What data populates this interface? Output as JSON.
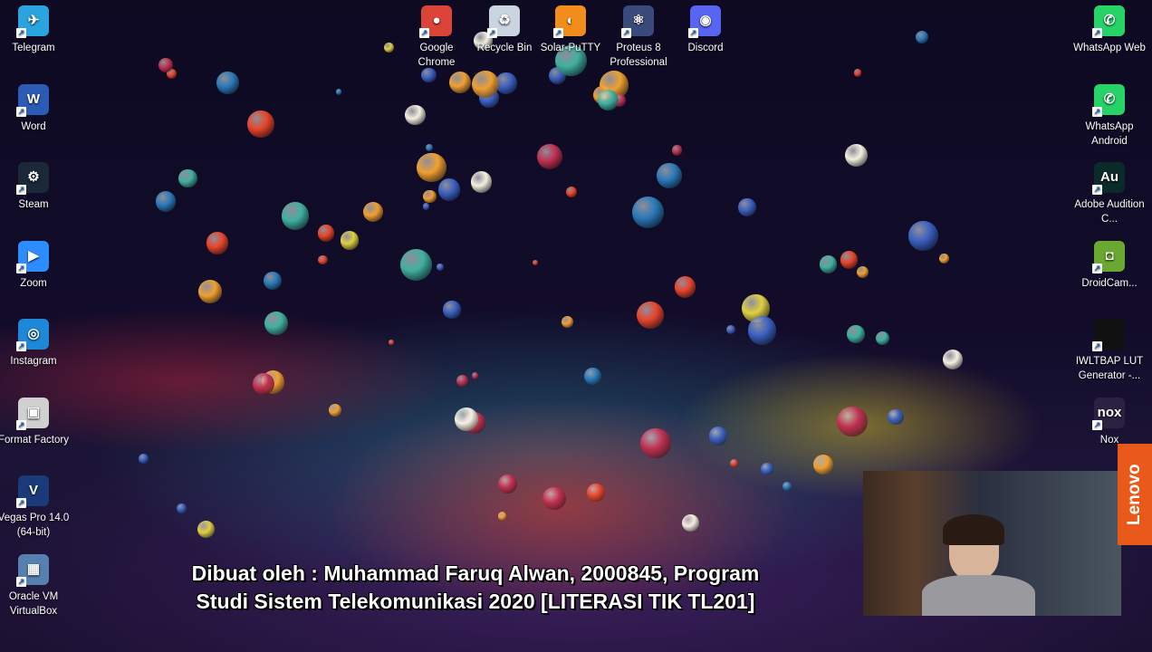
{
  "desktop_left": [
    {
      "label": "Telegram",
      "color": "#2aa3de",
      "sym": "✈"
    },
    {
      "label": "Word",
      "color": "#2b5bb5",
      "sym": "W"
    },
    {
      "label": "Steam",
      "color": "#1b2838",
      "sym": "⚙"
    },
    {
      "label": "Zoom",
      "color": "#2d8cff",
      "sym": "▶"
    },
    {
      "label": "Instagram",
      "color": "#1e88d8",
      "sym": "◎"
    },
    {
      "label": "Format Factory",
      "color": "#d0d0d0",
      "sym": "▣"
    },
    {
      "label": "Vegas Pro 14.0 (64-bit)",
      "color": "#1a3a7a",
      "sym": "V"
    },
    {
      "label": "Oracle VM VirtualBox",
      "color": "#5580b0",
      "sym": "▦"
    }
  ],
  "desktop_top": [
    {
      "label": "Google Chrome",
      "color": "#db4437",
      "sym": "●"
    },
    {
      "label": "Recycle Bin",
      "color": "#c9d4e0",
      "sym": "♻"
    },
    {
      "label": "Solar-PuTTY",
      "color": "#f28c1a",
      "sym": "◐"
    },
    {
      "label": "Proteus 8 Professional",
      "color": "#3a4a7a",
      "sym": "⚛"
    },
    {
      "label": "Discord",
      "color": "#5865f2",
      "sym": "◉"
    }
  ],
  "desktop_right": [
    {
      "label": "WhatsApp Web",
      "color": "#25d366",
      "sym": "✆"
    },
    {
      "label": "WhatsApp Android",
      "color": "#25d366",
      "sym": "✆"
    },
    {
      "label": "Adobe Audition C...",
      "color": "#0b2a2a",
      "sym": "Au"
    },
    {
      "label": "DroidCam...",
      "color": "#6aa832",
      "sym": "◘"
    },
    {
      "label": "IWLTBAP LUT Generator -...",
      "color": "#111111",
      "sym": ""
    },
    {
      "label": "Nox",
      "color": "#2a2240",
      "sym": "nox"
    }
  ],
  "caption": {
    "line1": "Dibuat oleh : Muhammad Faruq Alwan, 2000845, Program",
    "line2": "Studi Sistem Telekomunikasi 2020 [LITERASI TIK TL201]"
  },
  "webcam": {
    "brand": "Lenovo"
  }
}
